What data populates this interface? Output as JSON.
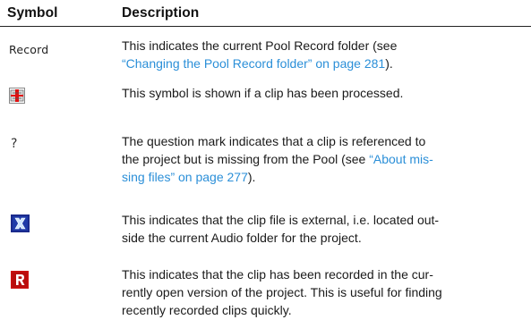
{
  "table": {
    "headers": {
      "symbol": "Symbol",
      "description": "Description"
    },
    "rows": [
      {
        "symbol_text": "Record",
        "lines": [
          [
            {
              "t": "This indicates the current Pool Record folder (see",
              "link": false
            }
          ],
          [
            {
              "t": "“Changing the Pool Record folder” on page 281",
              "link": true
            },
            {
              "t": ").",
              "link": false
            }
          ]
        ]
      },
      {
        "icon": "processed-clip-icon",
        "lines": [
          [
            {
              "t": "This symbol is shown if a clip has been processed.",
              "link": false
            }
          ]
        ]
      },
      {
        "symbol_text": "?",
        "lines": [
          [
            {
              "t": "The question mark indicates that a clip is referenced to",
              "link": false
            }
          ],
          [
            {
              "t": "the project but is missing from the Pool (see ",
              "link": false
            },
            {
              "t": "“About mis-",
              "link": true
            }
          ],
          [
            {
              "t": "sing files” on page 277",
              "link": true
            },
            {
              "t": ").",
              "link": false
            }
          ]
        ]
      },
      {
        "icon": "external-file-icon",
        "lines": [
          [
            {
              "t": "This indicates that the clip file is external, i.e. located out-",
              "link": false
            }
          ],
          [
            {
              "t": "side the current Audio folder for the project.",
              "link": false
            }
          ]
        ]
      },
      {
        "icon": "recorded-clip-icon",
        "lines": [
          [
            {
              "t": "This indicates that the clip has been recorded in the cur-",
              "link": false
            }
          ],
          [
            {
              "t": "rently open version of the project. This is useful for finding",
              "link": false
            }
          ],
          [
            {
              "t": "recently recorded clips quickly.",
              "link": false
            }
          ]
        ]
      }
    ]
  },
  "colors": {
    "link": "#2b8fd8",
    "processed_red": "#e01010",
    "external_blue": "#1a2a8c",
    "recorded_red": "#cc1010"
  }
}
